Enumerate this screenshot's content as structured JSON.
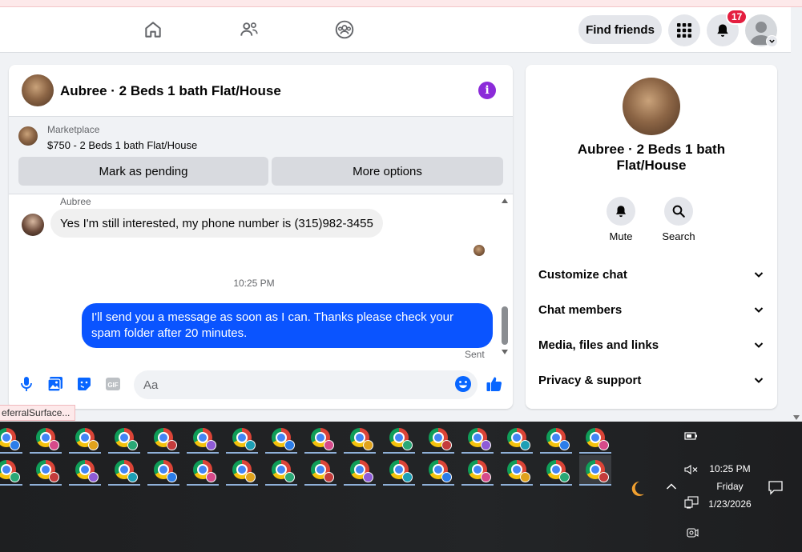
{
  "header": {
    "find_friends_label": "Find friends",
    "notification_count": "17",
    "nav_icons": [
      "home-icon",
      "friends-icon",
      "groups-icon"
    ],
    "right_icons": [
      "menu-grid-icon",
      "bell-icon",
      "profile-avatar"
    ]
  },
  "chat": {
    "title": "Aubree · 2 Beds 1 bath Flat/House",
    "marketplace": {
      "label": "Marketplace",
      "listing": "$750 - 2 Beds 1 bath Flat/House",
      "mark_pending_label": "Mark as pending",
      "more_options_label": "More options"
    },
    "messages": {
      "sender_name": "Aubree",
      "incoming_text": "Yes I'm still interested, my phone number is (315)982-3455",
      "timestamp": "10:25 PM",
      "outgoing_text": "I'll send you a message as soon as I can. Thanks please check your spam folder after 20 minutes.",
      "sent_label": "Sent"
    },
    "composer": {
      "placeholder": "Aa",
      "icons": [
        "microphone-icon",
        "photo-icon",
        "sticker-icon",
        "gif-icon",
        "emoji-icon",
        "thumbs-up-icon"
      ]
    }
  },
  "info_panel": {
    "title": "Aubree · 2 Beds 1 bath Flat/House",
    "actions": [
      {
        "label": "Mute",
        "icon": "bell-icon"
      },
      {
        "label": "Search",
        "icon": "search-icon"
      }
    ],
    "sections": [
      {
        "label": "Customize chat"
      },
      {
        "label": "Chat members"
      },
      {
        "label": "Media, files and links"
      },
      {
        "label": "Privacy & support"
      }
    ]
  },
  "tooltip_fragment": "eferralSurface...",
  "taskbar": {
    "time": "10:25 PM",
    "day": "Friday",
    "date": "1/23/2026",
    "profile_colors": [
      "#2b7de9",
      "#d64a8a",
      "#e0a21c",
      "#2aa876",
      "#c43c3c",
      "#8e5bd6",
      "#1d9fb5"
    ]
  },
  "colors": {
    "accent": "#0a54ff",
    "info_purple": "#8b2bd9",
    "fb_blue": "#1877f2",
    "badge_red": "#e41e3f"
  }
}
